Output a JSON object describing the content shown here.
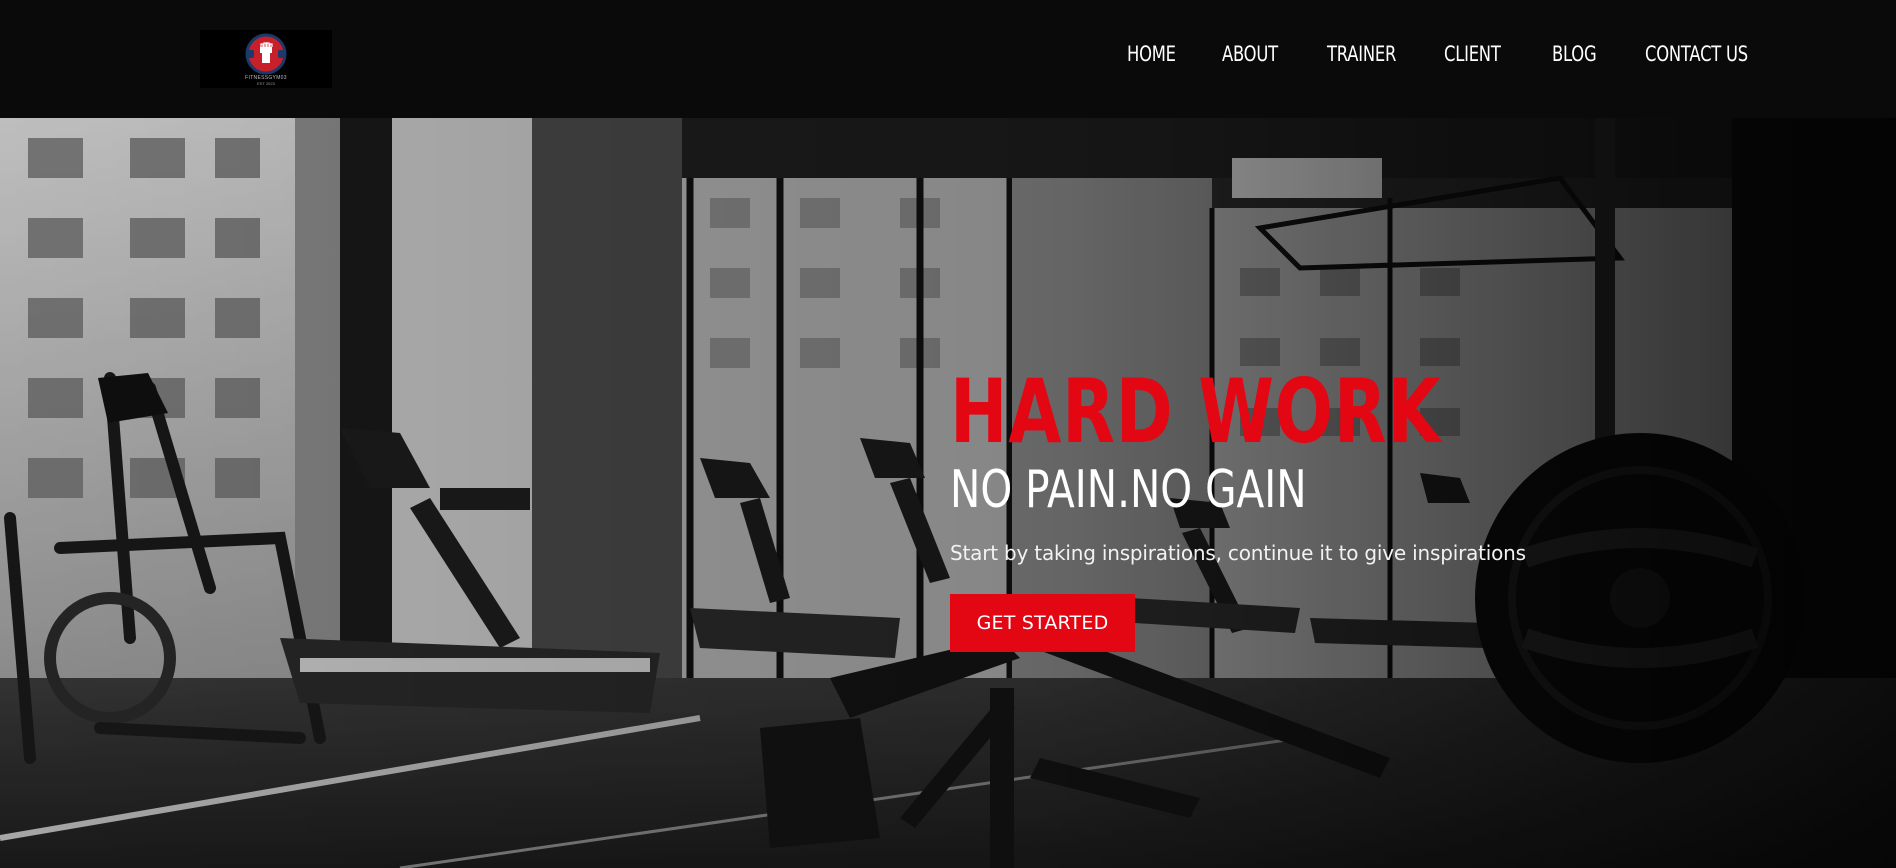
{
  "brand": {
    "logo_name": "FITNESSGYM03",
    "logo_est": "EST 2023",
    "colors": {
      "accent": "#e30613",
      "topbar": "#0a0a0a",
      "text": "#ffffff"
    }
  },
  "nav": {
    "items": [
      {
        "label": "HOME"
      },
      {
        "label": "ABOUT"
      },
      {
        "label": "TRAINER"
      },
      {
        "label": "CLIENT"
      },
      {
        "label": "BLOG"
      },
      {
        "label": "CONTACT US"
      }
    ]
  },
  "hero": {
    "headline": "HARD WORK",
    "subhead": "NO PAIN.NO GAIN",
    "tagline": "Start by taking inspirations, continue it to give inspirations",
    "cta_label": "GET STARTED",
    "background_image": "gym-interior-photo"
  }
}
